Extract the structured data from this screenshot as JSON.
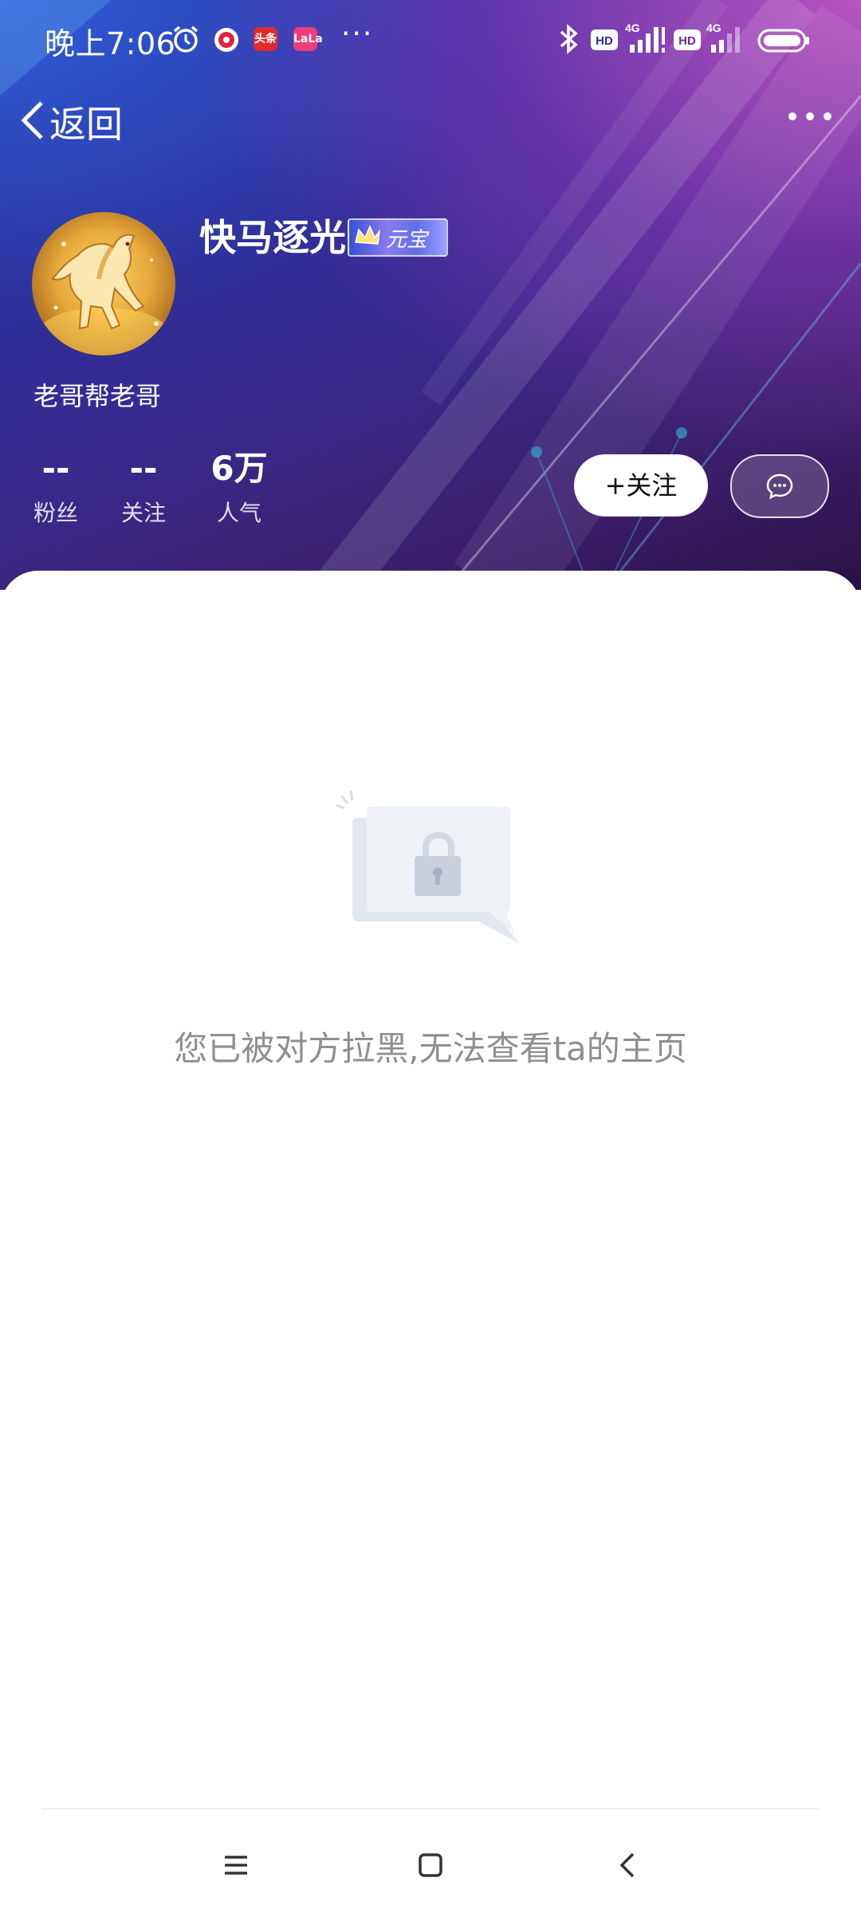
{
  "status_bar": {
    "time": "晚上7:06",
    "badges": [
      "头条",
      "LaLa"
    ],
    "more": "···",
    "net1": "4G",
    "net2": "4G",
    "hd": "HD"
  },
  "nav": {
    "back_label": "返回"
  },
  "profile": {
    "username": "快马逐光",
    "vip_badge_text": "元宝",
    "bio": "老哥帮老哥",
    "stats": [
      {
        "value": "--",
        "label": "粉丝"
      },
      {
        "value": "--",
        "label": "关注"
      },
      {
        "value": "6万",
        "label": "人气"
      }
    ],
    "follow_label": "+关注"
  },
  "content": {
    "blocked_message": "您已被对方拉黑,无法查看ta的主页"
  },
  "colors": {
    "header_start": "#233aa8",
    "header_end": "#2a1244",
    "header_pink": "#d25ac8",
    "message_text": "#8f8f8f"
  }
}
